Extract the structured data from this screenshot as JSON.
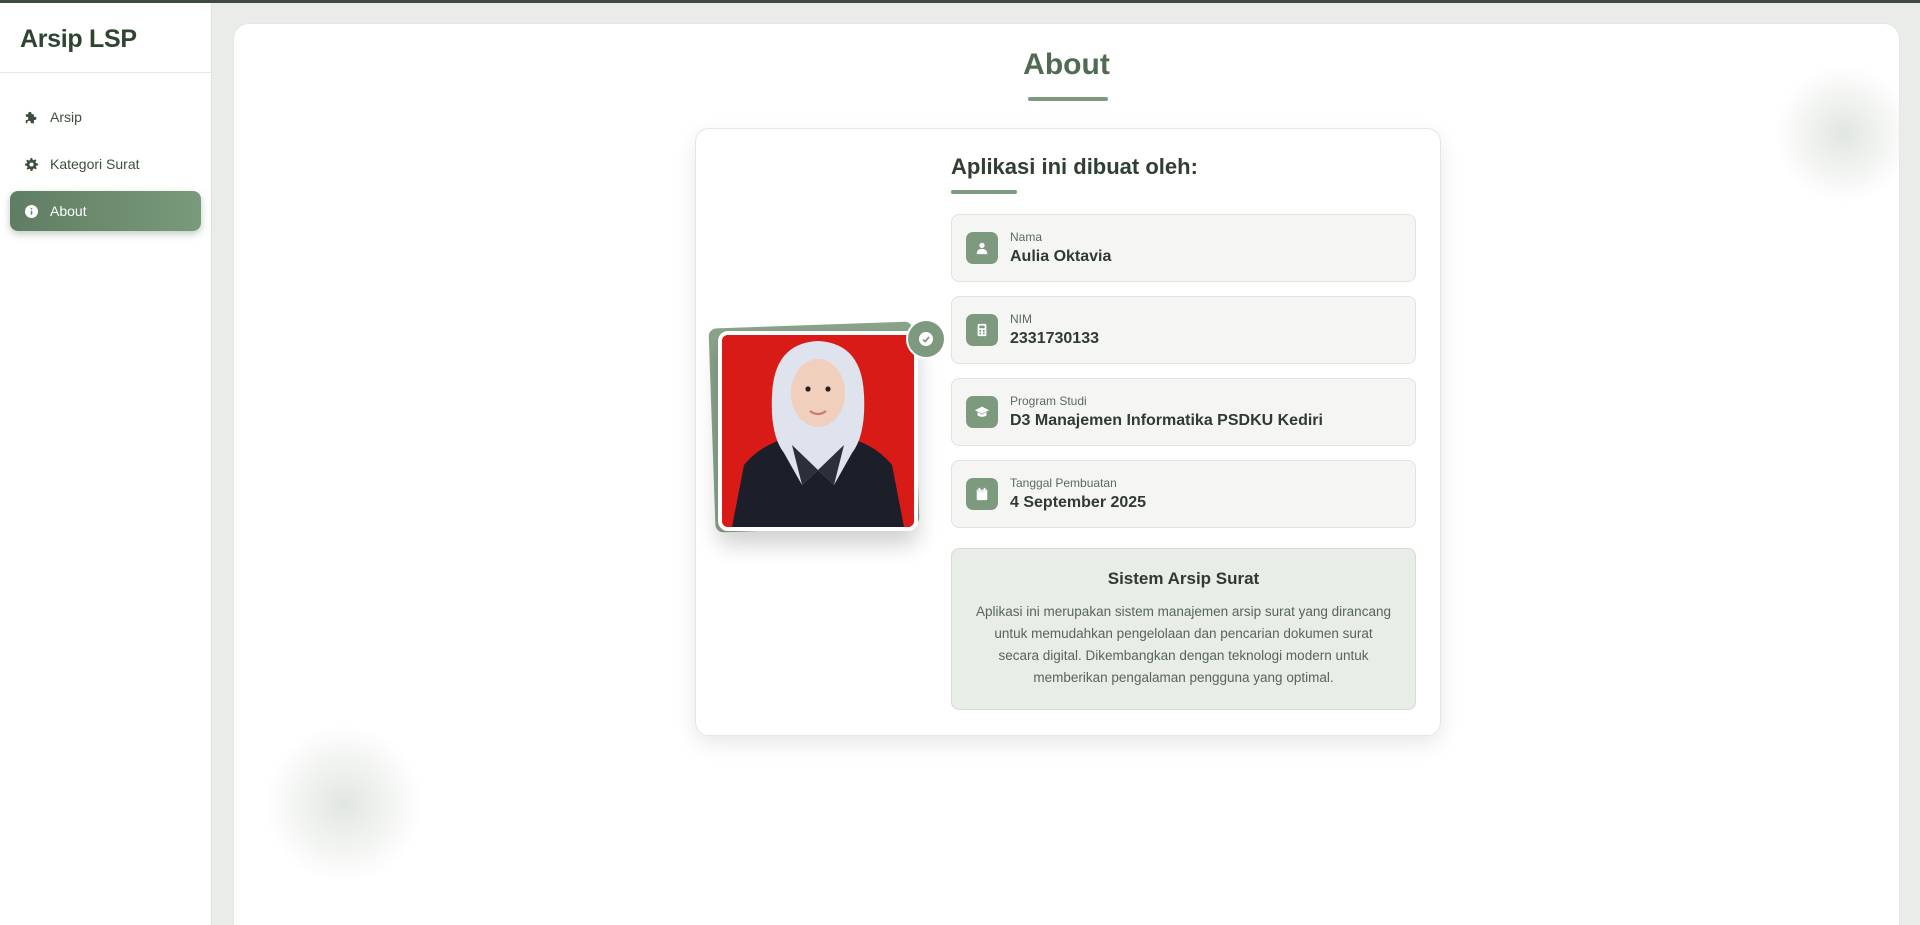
{
  "app": {
    "title": "Arsip LSP"
  },
  "sidebar": {
    "items": [
      {
        "label": "Arsip",
        "icon": "puzzle-icon",
        "active": false
      },
      {
        "label": "Kategori Surat",
        "icon": "gear-icon",
        "active": false
      },
      {
        "label": "About",
        "icon": "info-icon",
        "active": true
      }
    ]
  },
  "page": {
    "title": "About"
  },
  "about": {
    "heading": "Aplikasi ini dibuat oleh:",
    "fields": [
      {
        "label": "Nama",
        "value": "Aulia Oktavia",
        "icon": "user-icon"
      },
      {
        "label": "NIM",
        "value": "2331730133",
        "icon": "calculator-icon"
      },
      {
        "label": "Program Studi",
        "value": "D3 Manajemen Informatika PSDKU Kediri",
        "icon": "graduation-cap-icon"
      },
      {
        "label": "Tanggal Pembuatan",
        "value": "4 September 2025",
        "icon": "calendar-icon"
      }
    ],
    "description": {
      "title": "Sistem Arsip Surat",
      "text": "Aplikasi ini merupakan sistem manajemen arsip surat yang dirancang untuk memudahkan pengelolaan dan pencarian dokumen surat secara digital. Dikembangkan dengan teknologi modern untuk memberikan pengalaman pengguna yang optimal."
    }
  },
  "colors": {
    "accent": "#7d9a7f",
    "accent_dark": "#5f7d62",
    "photo_background": "#d81b16"
  }
}
